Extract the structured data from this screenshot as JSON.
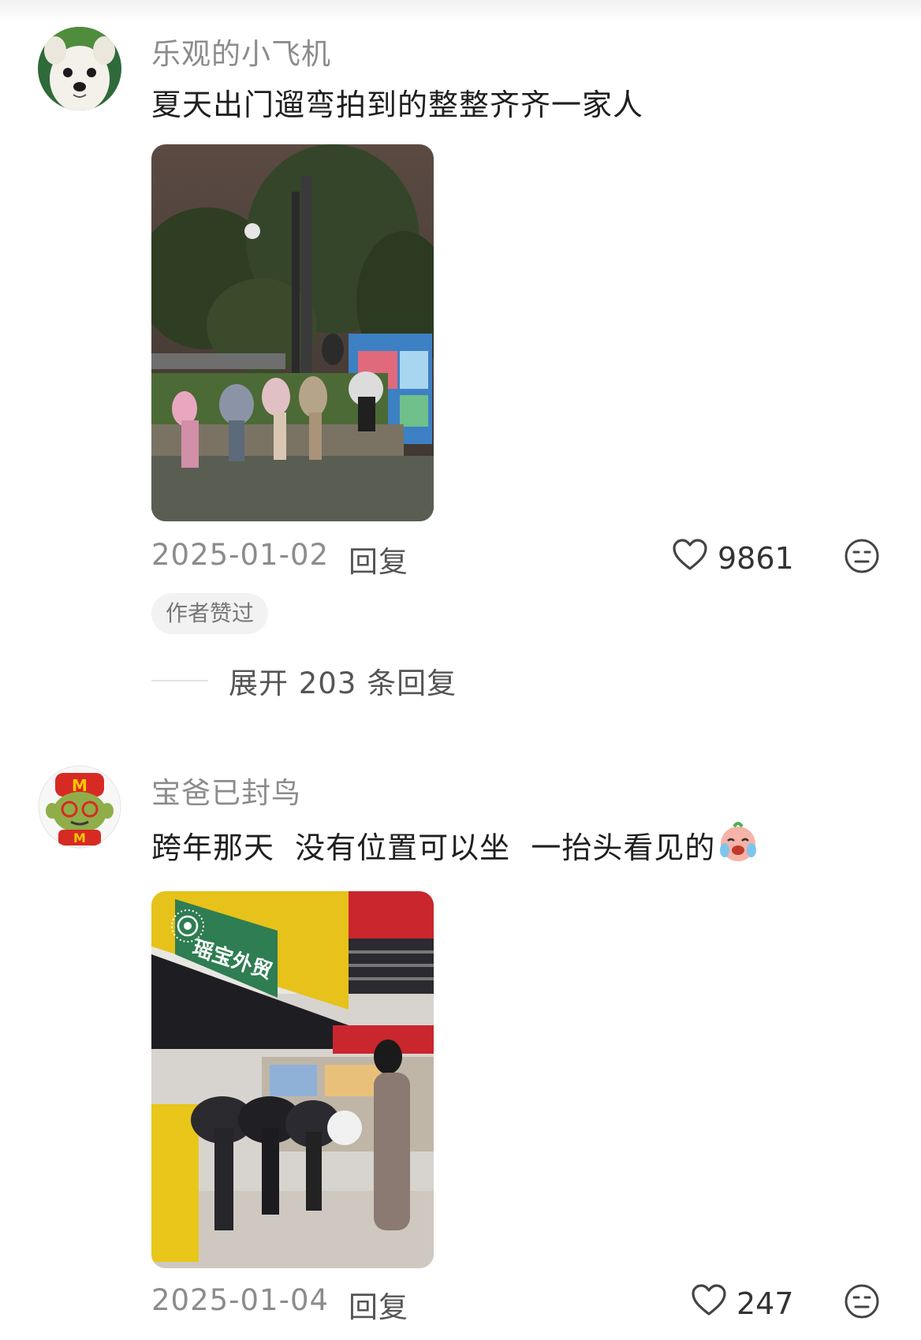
{
  "comments": [
    {
      "username": "乐观的小飞机",
      "text": "夏天出门遛弯拍到的整整齐齐一家人",
      "date": "2025-01-02",
      "reply_label": "回复",
      "likes": "9861",
      "author_liked_tag": "作者赞过",
      "expand_label": "展开 203 条回复"
    },
    {
      "username": "宝爸已封鸟",
      "text": "跨年那天  没有位置可以坐  一抬头看见的",
      "date": "2025-01-04",
      "reply_label": "回复",
      "likes": "247",
      "photo_sign": "瑶宝外贸"
    }
  ],
  "icons": {
    "like": "heart-outline-icon",
    "dislike": "neutral-face-icon",
    "emoji": "crying-laugh-emoji-icon",
    "live_photo": "live-photo-icon"
  },
  "colors": {
    "username": "#8c8c8c",
    "text": "#1f1f1f",
    "tag_bg": "#f2f2f2"
  }
}
